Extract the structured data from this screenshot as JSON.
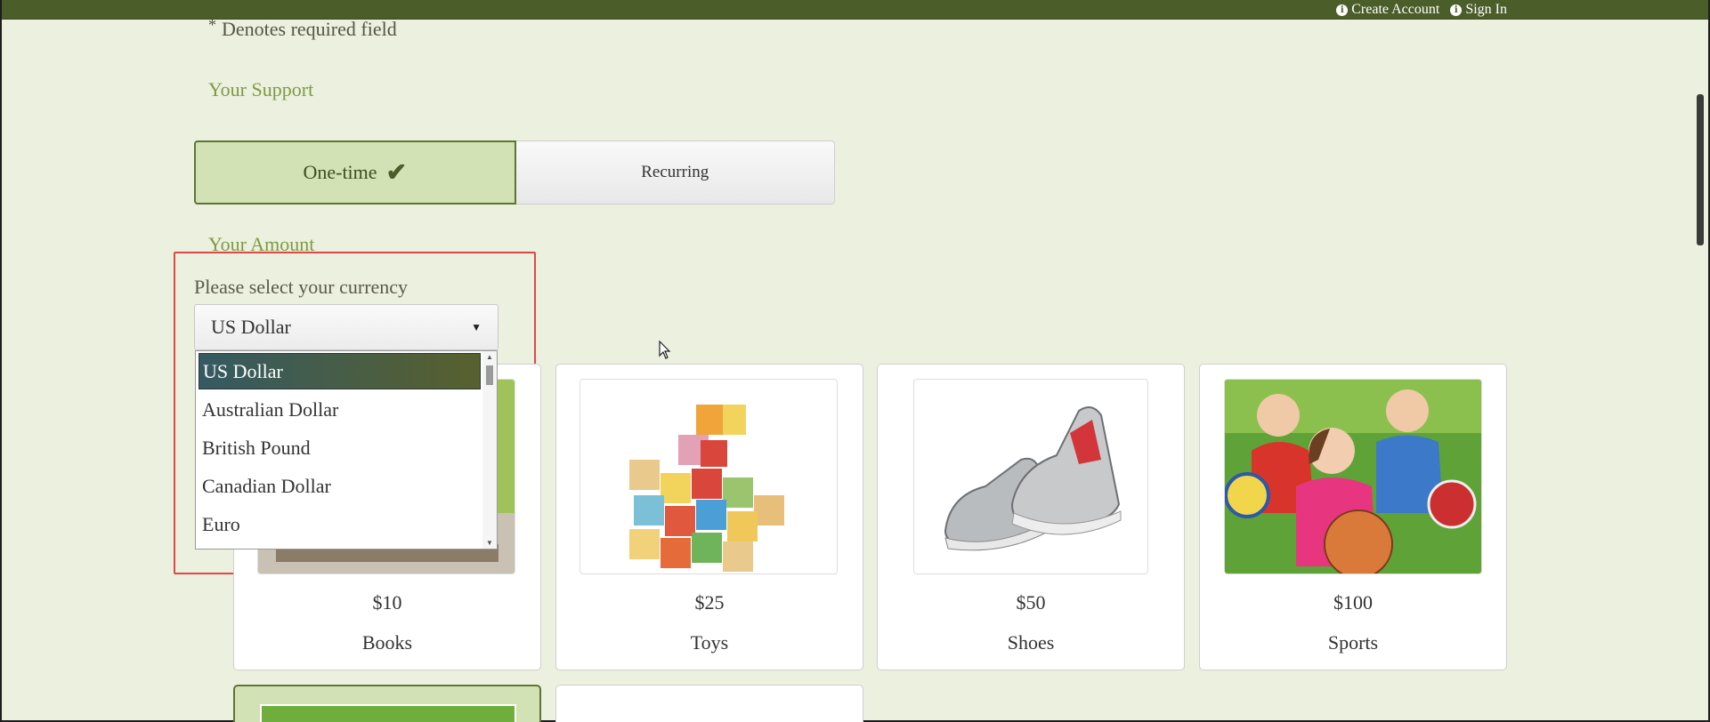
{
  "header": {
    "links": [
      {
        "label": "Create Account",
        "icon": "info-icon"
      },
      {
        "label": "Sign In",
        "icon": "info-icon"
      }
    ]
  },
  "form": {
    "required_note": "Denotes required field",
    "required_marker": "*",
    "support_heading": "Your Support",
    "support_options": {
      "one_time": "One-time",
      "recurring": "Recurring",
      "selected": "One-time"
    },
    "amount_heading": "Your Amount",
    "currency_label": "Please select your currency",
    "currency_selected": "US Dollar",
    "currency_options": [
      "US Dollar",
      "Australian Dollar",
      "British Pound",
      "Canadian Dollar",
      "Euro"
    ]
  },
  "cards": [
    {
      "amount": "$10",
      "category": "Books"
    },
    {
      "amount": "$25",
      "category": "Toys"
    },
    {
      "amount": "$50",
      "category": "Shoes"
    },
    {
      "amount": "$100",
      "category": "Sports"
    }
  ],
  "colors": {
    "topbar": "#4b5e2a",
    "background": "#ecf0de",
    "accent": "#7f9a44",
    "selected_toggle": "#d3e2b4",
    "highlight_border": "#e04848"
  }
}
